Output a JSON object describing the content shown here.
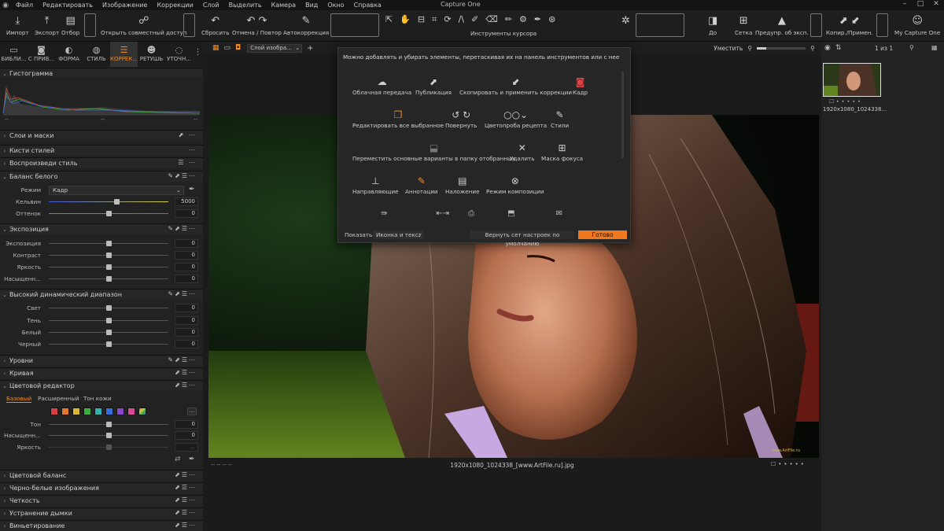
{
  "app": {
    "title": "Capture One"
  },
  "menu": [
    "Файл",
    "Редактировать",
    "Изображение",
    "Коррекции",
    "Слой",
    "Выделить",
    "Камера",
    "Вид",
    "Окно",
    "Справка"
  ],
  "toolbar": {
    "import": "Импорт",
    "export": "Экспорт",
    "select": "Отбор",
    "shared": "Открыть совместный доступ",
    "reset": "Сбросить",
    "undo_redo": "Отмена / Повтор",
    "autocorrect": "Автокоррекция",
    "cursor_tools": "Инструменты курсора",
    "before": "До",
    "grid": "Сетка",
    "exposure_warn": "Предупр. об эксп.",
    "copy_apply": "Копир./Примен.",
    "account": "My Capture One"
  },
  "tool_tabs": [
    {
      "label": "БИБЛИ...",
      "icon": "folder-icon"
    },
    {
      "label": "С ПРИВ...",
      "icon": "camera-icon"
    },
    {
      "label": "ФОРМА",
      "icon": "shape-icon"
    },
    {
      "label": "СТИЛЬ",
      "icon": "style-icon"
    },
    {
      "label": "КОРРЕК...",
      "icon": "sliders-icon"
    },
    {
      "label": "РЕТУШЬ",
      "icon": "retouch-icon"
    },
    {
      "label": "УТОЧН...",
      "icon": "refine-icon"
    }
  ],
  "viewer": {
    "layer_select": "Слой изобра...",
    "fit": "Уместить",
    "filename": "1920x1080_1024338_[www.ArtFile.ru].jpg",
    "dashes_left": "--    --    --    --",
    "watermark": "www.ArtFile.ru"
  },
  "browser": {
    "count": "1 из 1",
    "thumb_name": "1920x1080_1024338..."
  },
  "left_panel": {
    "histogram": "Гистограмма",
    "hist_dashes": [
      "--",
      "--",
      "--"
    ],
    "layers": "Слои и маски",
    "brushes": "Кисти стилей",
    "replay": "Воспроизведи стиль",
    "wb": {
      "title": "Баланс белого",
      "mode_label": "Режим",
      "mode_value": "Кадр",
      "kelvin_label": "Кельвин",
      "kelvin_value": "5000",
      "tint_label": "Оттенок",
      "tint_value": "0"
    },
    "exposure": {
      "title": "Экспозиция",
      "rows": [
        {
          "label": "Экспозиция",
          "value": "0"
        },
        {
          "label": "Контраст",
          "value": "0"
        },
        {
          "label": "Яркость",
          "value": "0"
        },
        {
          "label": "Насыщенн...",
          "value": "0"
        }
      ]
    },
    "hdr": {
      "title": "Высокий динамический диапазон",
      "rows": [
        {
          "label": "Свет",
          "value": "0"
        },
        {
          "label": "Тень",
          "value": "0"
        },
        {
          "label": "Белый",
          "value": "0"
        },
        {
          "label": "Черный",
          "value": "0"
        }
      ]
    },
    "levels": "Уровни",
    "curve": "Кривая",
    "color_editor": {
      "title": "Цветовой редактор",
      "tabs": [
        "Базовый",
        "Расширенный",
        "Тон кожи"
      ],
      "swatches": [
        "#d84040",
        "#e07830",
        "#d8b830",
        "#3cae3c",
        "#30b0b0",
        "#3070d8",
        "#8a48c8",
        "#d84898"
      ],
      "rows": [
        {
          "label": "Тон",
          "value": "0"
        },
        {
          "label": "Насыщенн...",
          "value": "0"
        },
        {
          "label": "Яркость",
          "value": "..."
        }
      ]
    },
    "color_balance": "Цветовой баланс",
    "bw": "Черно-белые изображения",
    "clarity": "Четкость",
    "dehaze": "Устранение дымки",
    "vignette": "Виньетирование"
  },
  "dialog": {
    "hint": "Можно добавлять и убирать элементы, перетаскивая их на панель инструментов или с нее",
    "items": [
      {
        "label": "Облачная передача",
        "icon": "cloud-upload-icon"
      },
      {
        "label": "Публикация",
        "icon": "publish-icon"
      },
      {
        "label": "Скопировать и применить коррекции",
        "icon": "copy-apply-icon"
      },
      {
        "label": "Кадр",
        "icon": "frame-icon"
      },
      {
        "label": "Редактировать все выбранное",
        "icon": "edit-all-icon"
      },
      {
        "label": "Повернуть",
        "icon": "rotate-icon"
      },
      {
        "label": "Цветопроба рецепта",
        "icon": "proof-icon"
      },
      {
        "label": "Стили",
        "icon": "styles-icon"
      },
      {
        "label": "Переместить основные варианты в папку отобранных",
        "icon": "move-icon"
      },
      {
        "label": "Удалить",
        "icon": "delete-icon"
      },
      {
        "label": "Маска фокуса",
        "icon": "focus-mask-icon"
      },
      {
        "label": "Направляющие",
        "icon": "guides-icon"
      },
      {
        "label": "Аннотации",
        "icon": "annotations-icon"
      },
      {
        "label": "Наложение",
        "icon": "overlay-icon"
      },
      {
        "label": "Режим композиции",
        "icon": "composition-icon"
      }
    ],
    "show_label": "Показать",
    "show_value": "Иконка и текст",
    "reset": "Вернуть сет настроек по умолчанию",
    "done": "Готово"
  }
}
